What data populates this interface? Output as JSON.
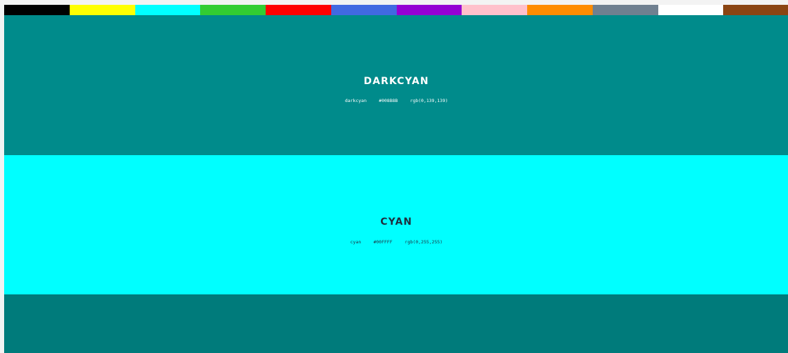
{
  "swatches": [
    {
      "name": "black",
      "color": "#000000"
    },
    {
      "name": "yellow",
      "color": "#FFFF00"
    },
    {
      "name": "cyan",
      "color": "#00FFFF"
    },
    {
      "name": "green",
      "color": "#32CD32"
    },
    {
      "name": "red",
      "color": "#FF0000"
    },
    {
      "name": "blue",
      "color": "#4169E1"
    },
    {
      "name": "purple",
      "color": "#9400D3"
    },
    {
      "name": "pink",
      "color": "#FFC0CB"
    },
    {
      "name": "orange",
      "color": "#FF8C00"
    },
    {
      "name": "gray",
      "color": "#708090"
    },
    {
      "name": "white",
      "color": "#FFFFFF"
    },
    {
      "name": "brown",
      "color": "#8B4513"
    }
  ],
  "panels": [
    {
      "title": "DARKCYAN",
      "name": "darkcyan",
      "hex": "#008B8B",
      "rgb": "rgb(0,139,139)",
      "background": "#008B8B",
      "text_color": "#FFFFFF"
    },
    {
      "title": "CYAN",
      "name": "cyan",
      "hex": "#00FFFF",
      "rgb": "rgb(0,255,255)",
      "background": "#00FFFF",
      "text_color": "#1F2F3F"
    },
    {
      "background": "#007B7B"
    }
  ]
}
